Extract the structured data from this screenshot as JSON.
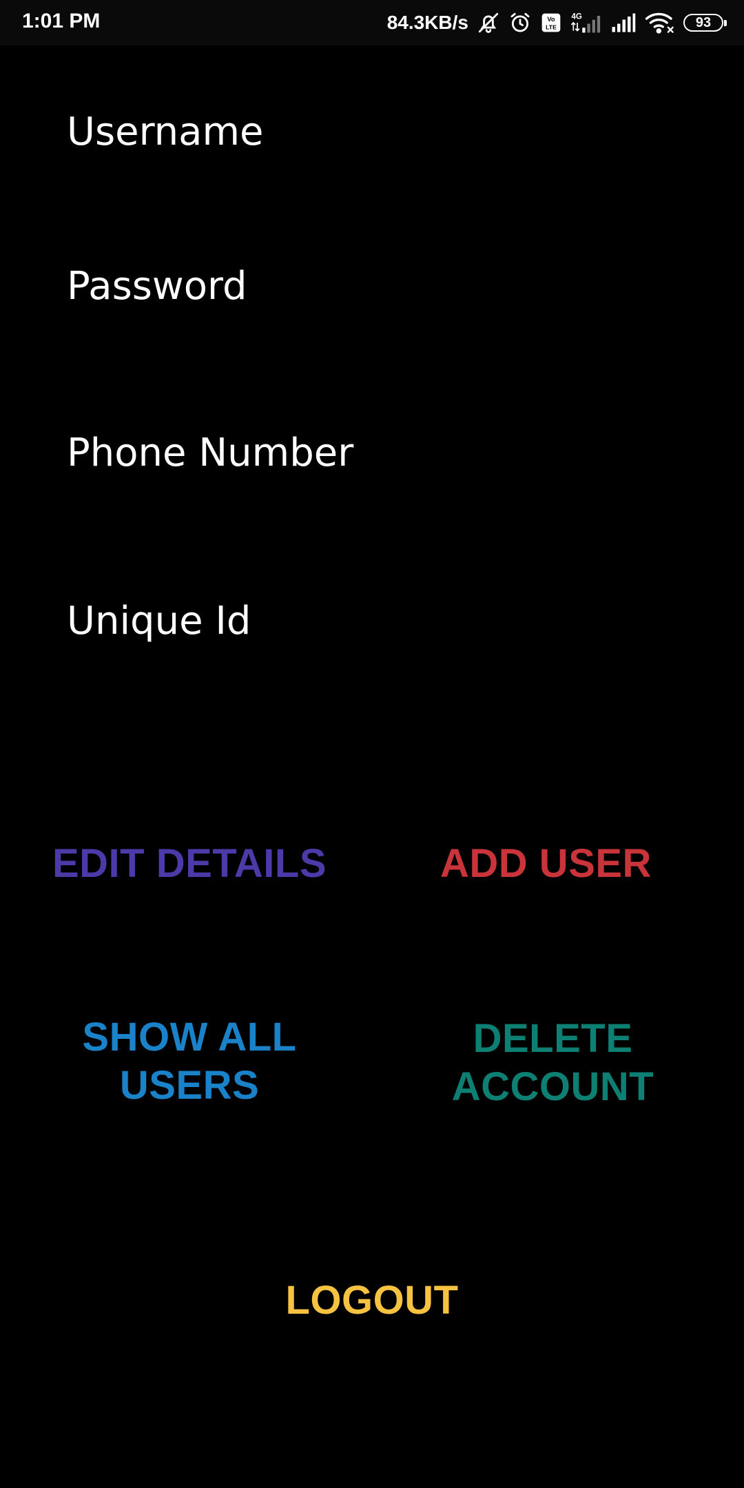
{
  "status_bar": {
    "time": "1:01 PM",
    "net_speed": "84.3KB/s",
    "battery_level": "93",
    "icons": [
      "bell-off-icon",
      "alarm-icon",
      "volte-icon",
      "4g-signal-icon",
      "signal-icon",
      "wifi-icon",
      "battery-icon"
    ]
  },
  "form": {
    "username_label": "Username",
    "password_label": "Password",
    "phone_label": "Phone Number",
    "unique_id_label": "Unique Id"
  },
  "actions": {
    "edit_details": "EDIT DETAILS",
    "add_user": "ADD USER",
    "show_all_users_line1": "SHOW ALL",
    "show_all_users_line2": "USERS",
    "delete_account_line1": "DELETE",
    "delete_account_line2": "ACCOUNT",
    "logout": "LOGOUT"
  },
  "colors": {
    "background": "#000000",
    "edit_details": "#4b3aa8",
    "add_user": "#c8343a",
    "show_all_users": "#1a82c8",
    "delete_account": "#0e7f73",
    "logout": "#f5c242"
  }
}
